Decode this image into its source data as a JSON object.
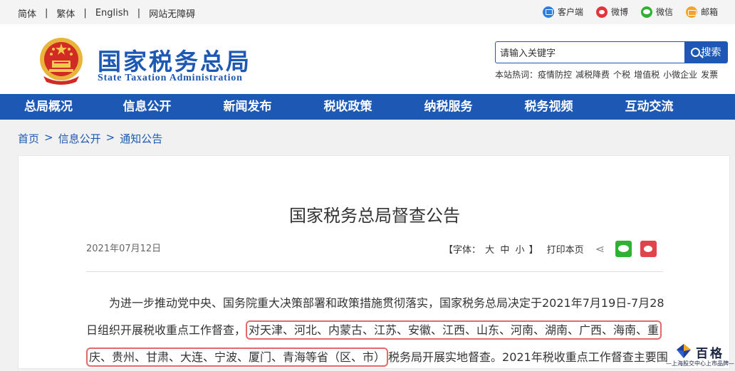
{
  "topbar": {
    "lang_simplified": "简体",
    "lang_traditional": "繁体",
    "lang_english": "English",
    "accessibility": "网站无障碍",
    "client": "客户端",
    "weibo": "微博",
    "wechat": "微信",
    "mail": "邮箱"
  },
  "brand": {
    "name_cn": "国家税务总局",
    "name_en": "State Taxation Administration"
  },
  "search": {
    "value": "请输入关键字",
    "button_label": "搜索",
    "hot_label": "本站热词：",
    "hot_words": [
      "疫情防控",
      "减税降费",
      "个税",
      "增值税",
      "小微企业",
      "发票"
    ]
  },
  "nav": {
    "items": [
      "总局概况",
      "信息公开",
      "新闻发布",
      "税收政策",
      "纳税服务",
      "税务视频",
      "互动交流"
    ]
  },
  "breadcrumb": {
    "home": "首页",
    "level1": "信息公开",
    "level2": "通知公告",
    "separator": ">"
  },
  "article": {
    "title": "国家税务总局督查公告",
    "date": "2021年07月12日",
    "font_label": "【字体：",
    "font_large": "大",
    "font_medium": "中",
    "font_small": "小",
    "font_close": "】",
    "print_label": "打印本页",
    "line1": "为进一步推动党中央、国务院重大决策部署和政策措施贯彻落实，国家税务总局决定于2021年7月19日-7月28",
    "line2_a": "日组织开展税收重点工作督查，",
    "line2_b": "对天津、河北、内蒙古、江苏、安徽、江西、山东、河南、湖南、广西、海南、重",
    "line3_a": "庆、贵州、甘肃、大连、宁波、厦门、青海等省（区、市）",
    "line3_b": "税务局开展实地督查。2021年税收重点工作督查主要围"
  },
  "watermark": {
    "name": "百格",
    "sub": "—上海股交中心上市品牌—"
  },
  "colors": {
    "brand_blue": "#1d58b4",
    "highlight_red": "#e46a6a"
  }
}
